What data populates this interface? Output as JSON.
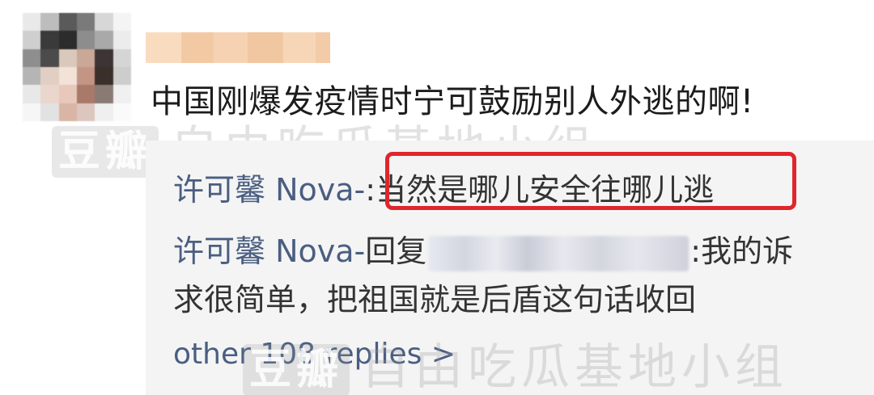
{
  "comment": {
    "text": "中国刚爆发疫情时宁可鼓励别人外逃的啊!"
  },
  "replies": [
    {
      "name": "许可馨 Nova-",
      "separator": ":",
      "text": "当然是哪儿安全往哪儿逃"
    },
    {
      "name": "许可馨 Nova-",
      "action": "回复",
      "after_mention": ":我的诉",
      "continuation": "求很简单，把祖国就是后盾这句话收回"
    }
  ],
  "more_replies": {
    "label": "other 108 replies >"
  },
  "watermark": {
    "logo": "豆瓣",
    "text": "自由吃瓜基地小组"
  },
  "colors": {
    "highlight_border": "#e0262b",
    "reply_name": "#4a5e80",
    "reply_background": "#f4f4f5",
    "text": "#1c1c1c"
  }
}
